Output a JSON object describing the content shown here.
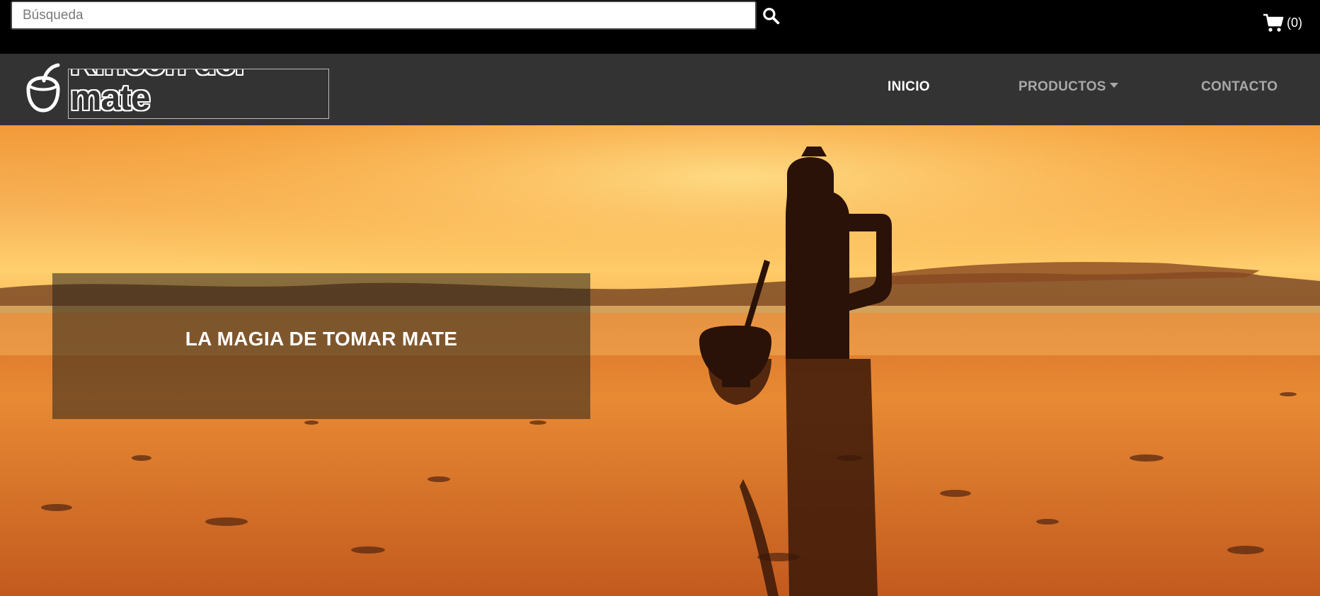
{
  "search": {
    "placeholder": "Búsqueda",
    "value": "",
    "button_icon": "search-icon"
  },
  "cart": {
    "icon": "shopping-cart-icon",
    "count_text": "(0)"
  },
  "brand": {
    "logo_icon": "mate-gourd-icon",
    "name": "Rincón del mate"
  },
  "nav": {
    "items": [
      {
        "label": "INICIO",
        "active": true
      },
      {
        "label": "PRODUCTOS",
        "dropdown": true
      },
      {
        "label": "CONTACTO"
      }
    ]
  },
  "hero": {
    "caption": "LA MAGIA DE TOMAR MATE"
  },
  "colors": {
    "topbar_bg": "#000000",
    "navbar_bg": "#333333",
    "nav_active": "#ffffff",
    "nav_inactive": "#a8a8a8",
    "sunset_orange": "#f08a2a",
    "sunset_yellow": "#ffd070"
  }
}
